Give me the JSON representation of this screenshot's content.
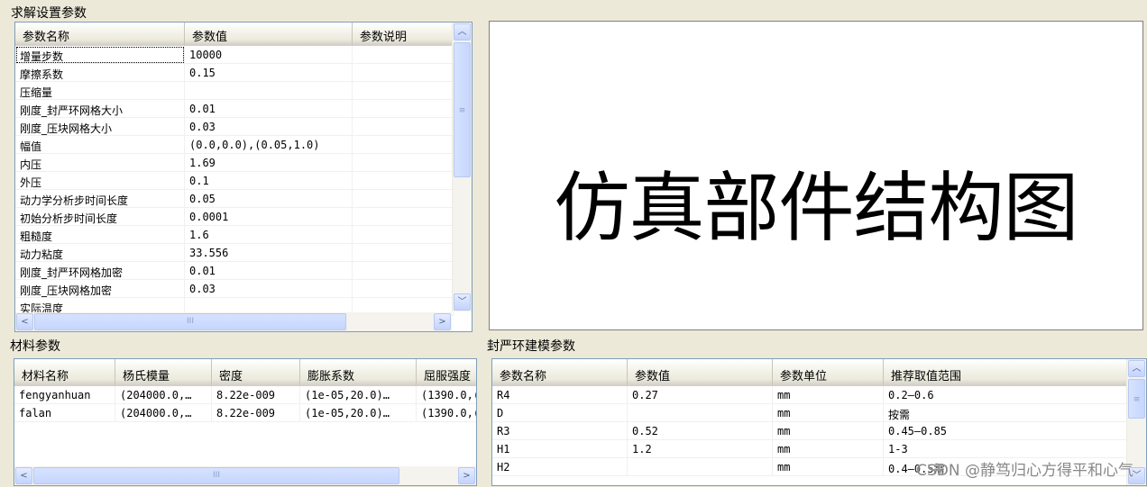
{
  "solver_group": {
    "title": "求解设置参数",
    "columns": [
      "参数名称",
      "参数值",
      "参数说明"
    ],
    "rows": [
      {
        "name": "增量步数",
        "value": "10000"
      },
      {
        "name": "摩擦系数",
        "value": "0.15"
      },
      {
        "name": "压缩量",
        "value": ""
      },
      {
        "name": "刚度_封严环网格大小",
        "value": "0.01"
      },
      {
        "name": "刚度_压块网格大小",
        "value": "0.03"
      },
      {
        "name": "幅值",
        "value": "(0.0,0.0),(0.05,1.0)"
      },
      {
        "name": "内压",
        "value": "1.69"
      },
      {
        "name": "外压",
        "value": "0.1"
      },
      {
        "name": "动力学分析步时间长度",
        "value": "0.05"
      },
      {
        "name": "初始分析步时间长度",
        "value": "0.0001"
      },
      {
        "name": "粗糙度",
        "value": "1.6"
      },
      {
        "name": "动力粘度",
        "value": "33.556"
      },
      {
        "name": "刚度_封严环网格加密",
        "value": "0.01"
      },
      {
        "name": "刚度_压块网格加密",
        "value": "0.03"
      },
      {
        "name": "实际温度",
        "value": ""
      }
    ]
  },
  "structure_picture": {
    "label": "仿真部件结构图"
  },
  "material_group": {
    "title": "材料参数",
    "columns": [
      "材料名称",
      "杨氏模量",
      "密度",
      "膨胀系数",
      "屈服强度"
    ],
    "rows": [
      [
        "fengyanhuan",
        "(204000.0,…",
        "8.22e-009",
        "(1e-05,20.0)…",
        "(1390.0,("
      ],
      [
        "falan",
        "(204000.0,…",
        "8.22e-009",
        "(1e-05,20.0)…",
        "(1390.0,("
      ]
    ]
  },
  "seal_group": {
    "title": "封严环建模参数",
    "columns": [
      "参数名称",
      "参数值",
      "参数单位",
      "推荐取值范围"
    ],
    "rows": [
      [
        "R4",
        "0.27",
        "mm",
        "0.2—0.6"
      ],
      [
        "D",
        "",
        "mm",
        "按需"
      ],
      [
        "R3",
        "0.52",
        "mm",
        "0.45—0.85"
      ],
      [
        "H1",
        "1.2",
        "mm",
        "1-3"
      ],
      [
        "H2",
        "",
        "mm",
        "0.4—0.5需"
      ]
    ]
  },
  "scroll_glyphs": {
    "up": "︿",
    "down": "﹀",
    "left": "<",
    "right": ">",
    "grip_v": "≡",
    "grip_h": "III"
  },
  "watermark": "CSDN @静笃归心方得平和心气"
}
